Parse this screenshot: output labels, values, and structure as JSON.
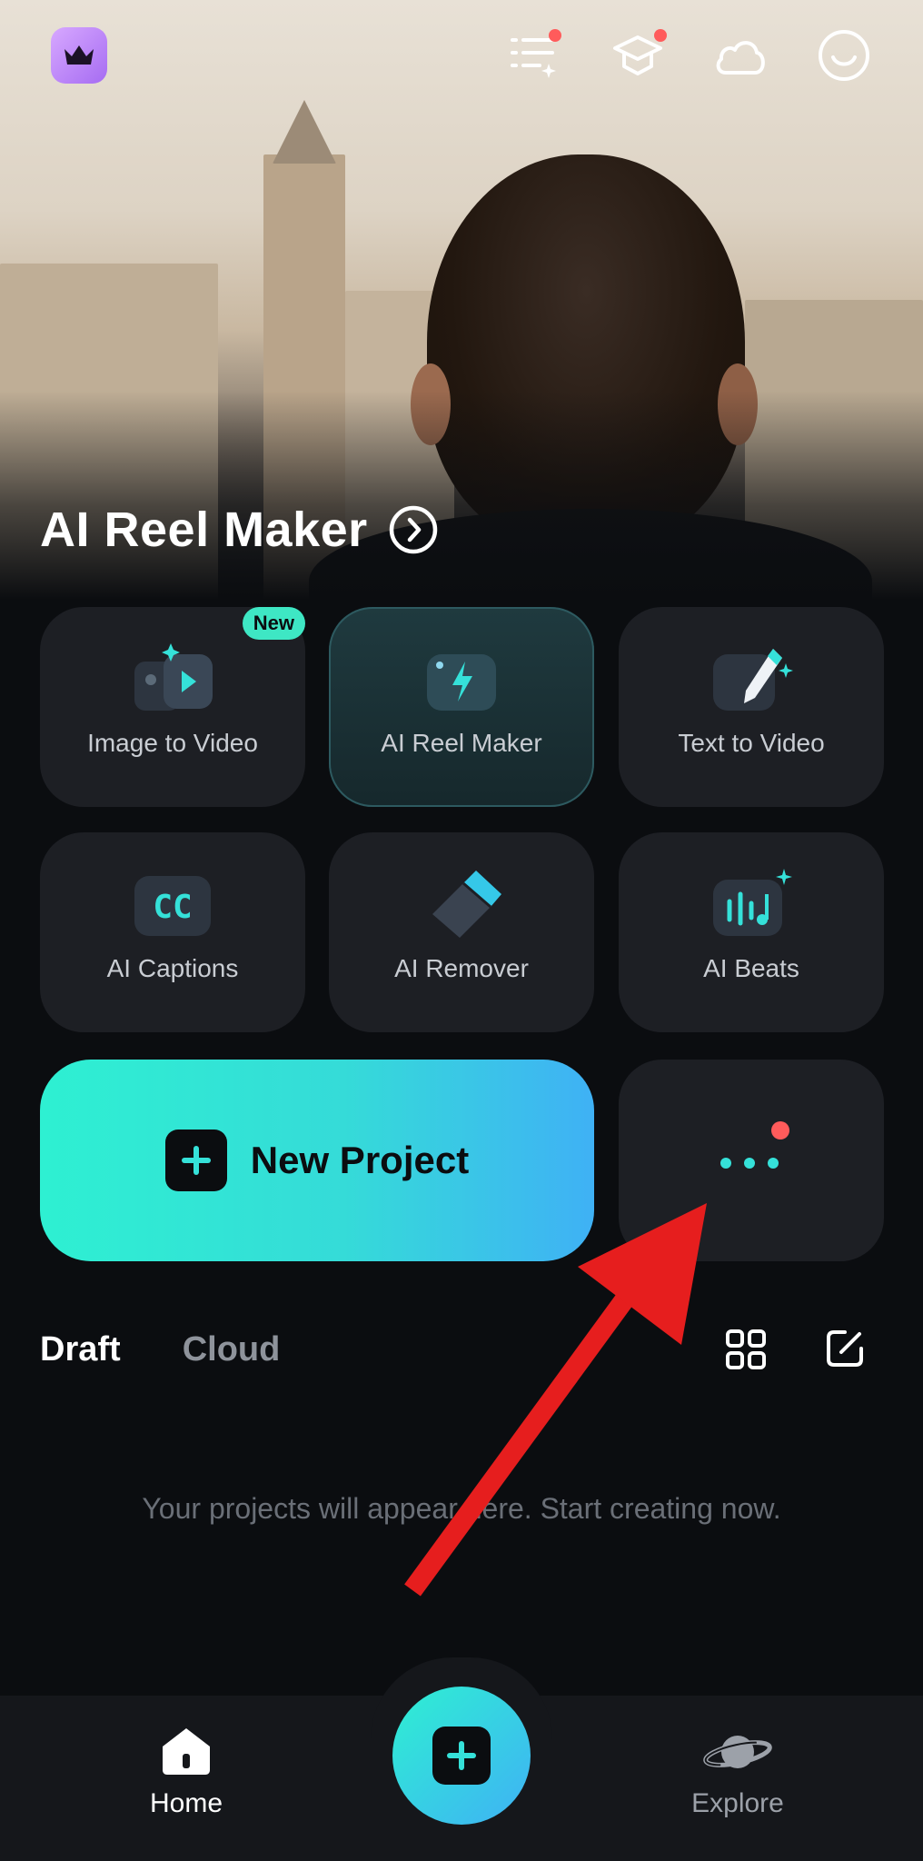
{
  "hero": {
    "title": "AI Reel Maker"
  },
  "tools": [
    {
      "label": "Image to Video",
      "badge": "New"
    },
    {
      "label": "AI Reel Maker"
    },
    {
      "label": "Text to Video"
    },
    {
      "label": "AI Captions",
      "icon_text": "CC"
    },
    {
      "label": "AI Remover"
    },
    {
      "label": "AI Beats"
    }
  ],
  "new_project": {
    "label": "New Project"
  },
  "tabs": {
    "draft": "Draft",
    "cloud": "Cloud"
  },
  "empty_state": "Your projects will appear here. Start creating now.",
  "bottom_nav": {
    "home": "Home",
    "explore": "Explore"
  },
  "colors": {
    "accent": "#2ef0d2",
    "accent_blue": "#3fb1f5",
    "badge_red": "#ff5b5b",
    "annotation_arrow": "#e61e1e"
  },
  "icons": [
    "crown-icon",
    "task-list-icon",
    "graduation-cap-icon",
    "cloud-icon",
    "smiley-icon",
    "chevron-right-circle-icon",
    "grid-view-icon",
    "edit-icon",
    "home-icon",
    "planet-icon",
    "plus-icon",
    "more-dots-icon"
  ]
}
